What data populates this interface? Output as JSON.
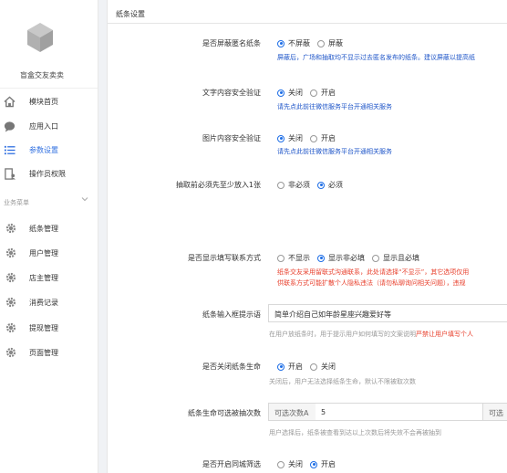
{
  "sidebar": {
    "app_name": "盲盒交友卖卖",
    "nav": [
      {
        "label": "模块首页",
        "icon": "home-icon"
      },
      {
        "label": "应用入口",
        "icon": "chat-icon"
      },
      {
        "label": "参数设置",
        "icon": "list-icon",
        "active": true
      },
      {
        "label": "操作员权限",
        "icon": "user-doc-icon"
      }
    ],
    "group_label": "业务菜单",
    "business": [
      {
        "label": "纸条管理",
        "icon": "gear-icon"
      },
      {
        "label": "用户管理",
        "icon": "gear-icon"
      },
      {
        "label": "店主管理",
        "icon": "gear-icon"
      },
      {
        "label": "消费记录",
        "icon": "gear-icon"
      },
      {
        "label": "提现管理",
        "icon": "gear-icon"
      },
      {
        "label": "页面管理",
        "icon": "gear-icon"
      }
    ]
  },
  "main": {
    "section_title": "纸条设置",
    "settings": {
      "anon": {
        "label": "是否屏蔽匿名纸条",
        "options": [
          "不屏蔽",
          "屏蔽"
        ],
        "selected": 0,
        "hint": "屏蔽后，广场和抽取均不显示过去匿名发布的纸条。建议屏蔽以提高纸"
      },
      "text_check": {
        "label": "文字内容安全验证",
        "options": [
          "关闭",
          "开启"
        ],
        "selected": 0,
        "hint": "请先点此前往微信服务平台开通相关服务"
      },
      "img_check": {
        "label": "图片内容安全验证",
        "options": [
          "关闭",
          "开启"
        ],
        "selected": 0,
        "hint": "请先点此前往微信服务平台开通相关服务"
      },
      "must_put": {
        "label": "抽取前必须先至少放入1张",
        "options": [
          "非必须",
          "必须"
        ],
        "selected": 1
      },
      "contact": {
        "label": "是否显示填写联系方式",
        "options": [
          "不显示",
          "显示非必填",
          "显示且必填"
        ],
        "selected": 1,
        "hint_line1": "纸条交友采用留联式沟通联系，此处请选择“不显示”，其它选项仅用",
        "hint_line2": "供联系方式可能扩散个人隐私违法（请勿私聊询问相关问题），违规"
      },
      "placeholder": {
        "label": "纸条输入框提示语",
        "value": "简单介绍自己如年龄星座兴趣爱好等",
        "hint_prefix": "在用户放纸条时，用于提示用户如何填写的文案说明",
        "hint_red": "严禁让用户填写个人"
      },
      "life": {
        "label": "是否关闭纸条生命",
        "options": [
          "开启",
          "关闭"
        ],
        "selected": 0,
        "hint": "关闭后，用户无法选择纸条生命，默认不限被取次数"
      },
      "times": {
        "label": "纸条生命可选被抽次数",
        "addon_left": "可选次数A",
        "value": "5",
        "addon_right": "可选",
        "hint": "用户选择后，纸条被查看到达以上次数后将失效不会再被抽到"
      },
      "city": {
        "label": "是否开启同城筛选",
        "options": [
          "关闭",
          "开启"
        ],
        "selected": 1
      }
    }
  }
}
